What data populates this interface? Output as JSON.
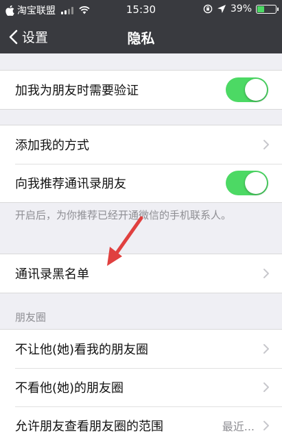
{
  "status_bar": {
    "carrier": "淘宝联盟",
    "time": "15:30",
    "battery": "39%",
    "battery_level": 0.39
  },
  "nav": {
    "back_label": "设置",
    "title": "隐私"
  },
  "settings": {
    "friend_verify": {
      "label": "加我为朋友时需要验证",
      "enabled": true
    },
    "add_methods": {
      "label": "添加我的方式"
    },
    "recommend_contacts": {
      "label": "向我推荐通讯录朋友",
      "enabled": true
    },
    "recommend_hint": "开启后，为你推荐已经开通微信的手机联系人。",
    "contacts_blacklist": {
      "label": "通讯录黑名单"
    }
  },
  "moments": {
    "header": "朋友圈",
    "items": [
      {
        "label": "不让他(她)看我的朋友圈"
      },
      {
        "label": "不看他(她)的朋友圈"
      },
      {
        "label": "允许朋友查看朋友圈的范围",
        "value": "最近..."
      }
    ]
  },
  "colors": {
    "nav_background": "#393a3f",
    "switch_on": "#4cd964",
    "annotation_arrow": "#e0403f"
  }
}
